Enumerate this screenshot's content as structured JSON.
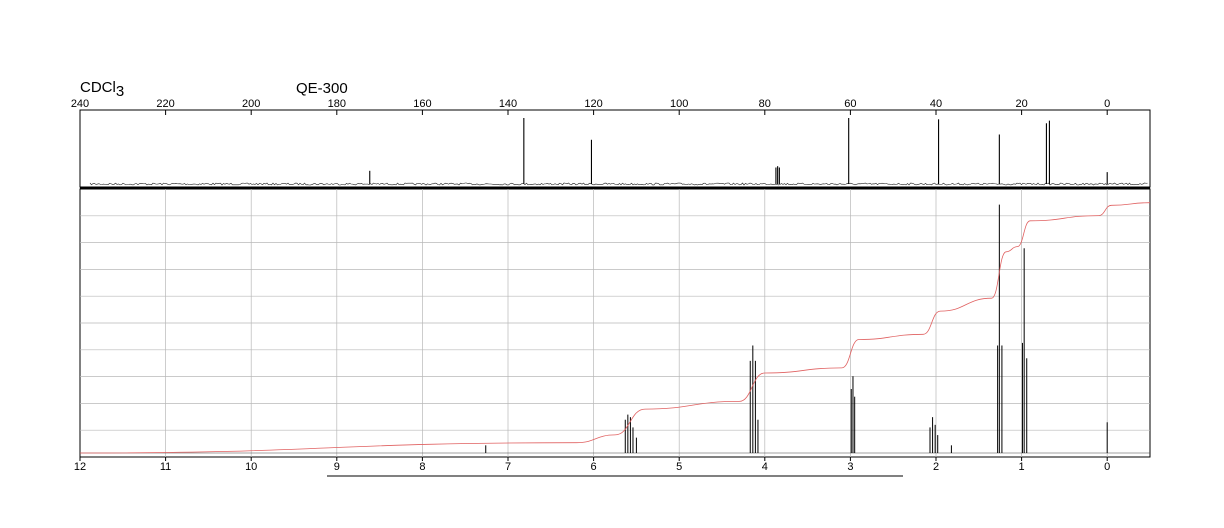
{
  "header": {
    "solvent": "CDCl",
    "solvent_subscript": "3",
    "instrument": "QE-300"
  },
  "chart_data": [
    {
      "type": "line",
      "name": "13C NMR spectrum",
      "xlabel": "",
      "ylabel": "",
      "xlim": [
        240,
        -10
      ],
      "x_reversed": true,
      "grid": false,
      "ticks": [
        240,
        220,
        200,
        180,
        160,
        140,
        120,
        100,
        80,
        60,
        40,
        20,
        0
      ],
      "tick_labels": [
        "240",
        "220",
        "200",
        "180",
        "160",
        "140",
        "120",
        "100",
        "80",
        "60",
        "40",
        "20",
        "0"
      ],
      "peaks": [
        {
          "shift": 172.3,
          "height": 0.2
        },
        {
          "shift": 136.3,
          "height": 1.0
        },
        {
          "shift": 120.5,
          "height": 0.67
        },
        {
          "shift": 77.4,
          "height": 0.25
        },
        {
          "shift": 77.0,
          "height": 0.27
        },
        {
          "shift": 76.6,
          "height": 0.25
        },
        {
          "shift": 60.4,
          "height": 1.0
        },
        {
          "shift": 39.4,
          "height": 0.98
        },
        {
          "shift": 25.2,
          "height": 0.75
        },
        {
          "shift": 14.2,
          "height": 0.92
        },
        {
          "shift": 13.5,
          "height": 0.96
        },
        {
          "shift": 0.0,
          "height": 0.18
        }
      ]
    },
    {
      "type": "line",
      "name": "1H NMR spectrum",
      "xlabel": "",
      "ylabel": "",
      "xlim": [
        12,
        -0.5
      ],
      "x_reversed": true,
      "grid": true,
      "ticks": [
        12,
        11,
        10,
        9,
        8,
        7,
        6,
        5,
        4,
        3,
        2,
        1,
        0
      ],
      "tick_labels": [
        "12",
        "11",
        "10",
        "9",
        "8",
        "7",
        "6",
        "5",
        "4",
        "3",
        "2",
        "1",
        "0"
      ],
      "peaks": [
        {
          "shift": 7.26,
          "height": 0.03
        },
        {
          "shift": 5.63,
          "height": 0.13
        },
        {
          "shift": 5.6,
          "height": 0.15
        },
        {
          "shift": 5.57,
          "height": 0.14
        },
        {
          "shift": 5.54,
          "height": 0.1
        },
        {
          "shift": 5.5,
          "height": 0.06
        },
        {
          "shift": 4.17,
          "height": 0.36
        },
        {
          "shift": 4.14,
          "height": 0.42
        },
        {
          "shift": 4.11,
          "height": 0.36
        },
        {
          "shift": 4.08,
          "height": 0.13
        },
        {
          "shift": 2.99,
          "height": 0.25
        },
        {
          "shift": 2.97,
          "height": 0.3
        },
        {
          "shift": 2.95,
          "height": 0.22
        },
        {
          "shift": 2.07,
          "height": 0.1
        },
        {
          "shift": 2.04,
          "height": 0.14
        },
        {
          "shift": 2.01,
          "height": 0.11
        },
        {
          "shift": 1.98,
          "height": 0.07
        },
        {
          "shift": 1.82,
          "height": 0.03
        },
        {
          "shift": 1.28,
          "height": 0.42
        },
        {
          "shift": 1.26,
          "height": 0.97
        },
        {
          "shift": 1.23,
          "height": 0.42
        },
        {
          "shift": 0.99,
          "height": 0.43
        },
        {
          "shift": 0.97,
          "height": 0.8
        },
        {
          "shift": 0.94,
          "height": 0.37
        },
        {
          "shift": 0.0,
          "height": 0.12
        }
      ],
      "integral": [
        [
          12,
          0.0
        ],
        [
          6.2,
          0.04
        ],
        [
          5.75,
          0.07
        ],
        [
          5.4,
          0.17
        ],
        [
          4.3,
          0.2
        ],
        [
          4.0,
          0.31
        ],
        [
          3.1,
          0.33
        ],
        [
          2.9,
          0.44
        ],
        [
          2.15,
          0.46
        ],
        [
          1.95,
          0.55
        ],
        [
          1.35,
          0.6
        ],
        [
          1.18,
          0.78
        ],
        [
          1.05,
          0.8
        ],
        [
          0.9,
          0.9
        ],
        [
          0.1,
          0.92
        ],
        [
          -0.05,
          0.96
        ],
        [
          -0.5,
          0.97
        ]
      ]
    }
  ]
}
